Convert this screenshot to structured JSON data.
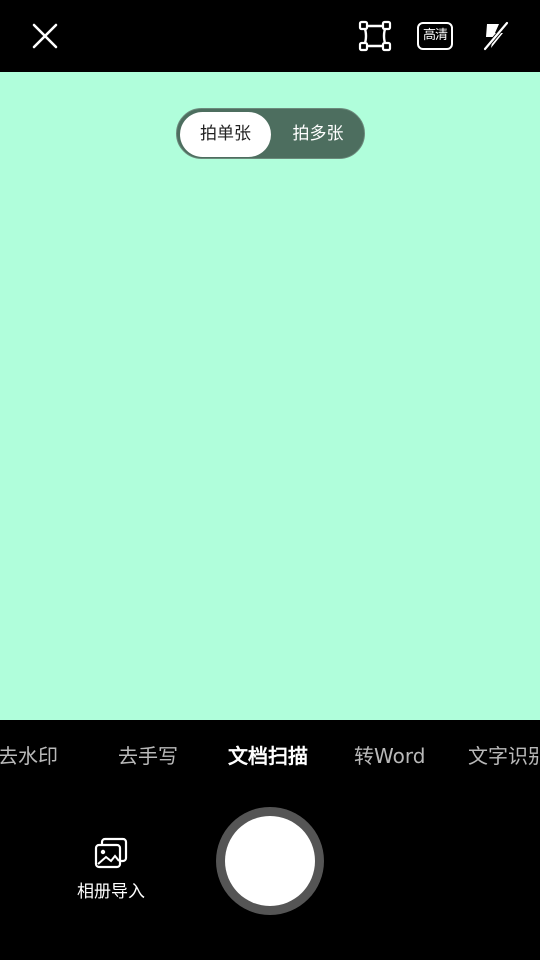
{
  "topbar": {
    "close_icon": "close-icon",
    "crop_icon": "crop-frame-icon",
    "hd_label": "高清",
    "flash_icon": "flash-off-icon"
  },
  "mode_toggle": {
    "single": "拍单张",
    "multi": "拍多张",
    "selected": "single"
  },
  "tools": {
    "items": [
      "去水印",
      "去手写",
      "文档扫描",
      "转Word",
      "文字识别"
    ],
    "active": "文档扫描"
  },
  "album": {
    "icon": "gallery-icon",
    "label": "相册导入"
  },
  "shutter": {
    "icon": "shutter-button"
  },
  "colors": {
    "viewfinder": "#b0fedb",
    "toggle_bg": "#4d6e5f",
    "inactive_tool": "#b9b9b9"
  }
}
